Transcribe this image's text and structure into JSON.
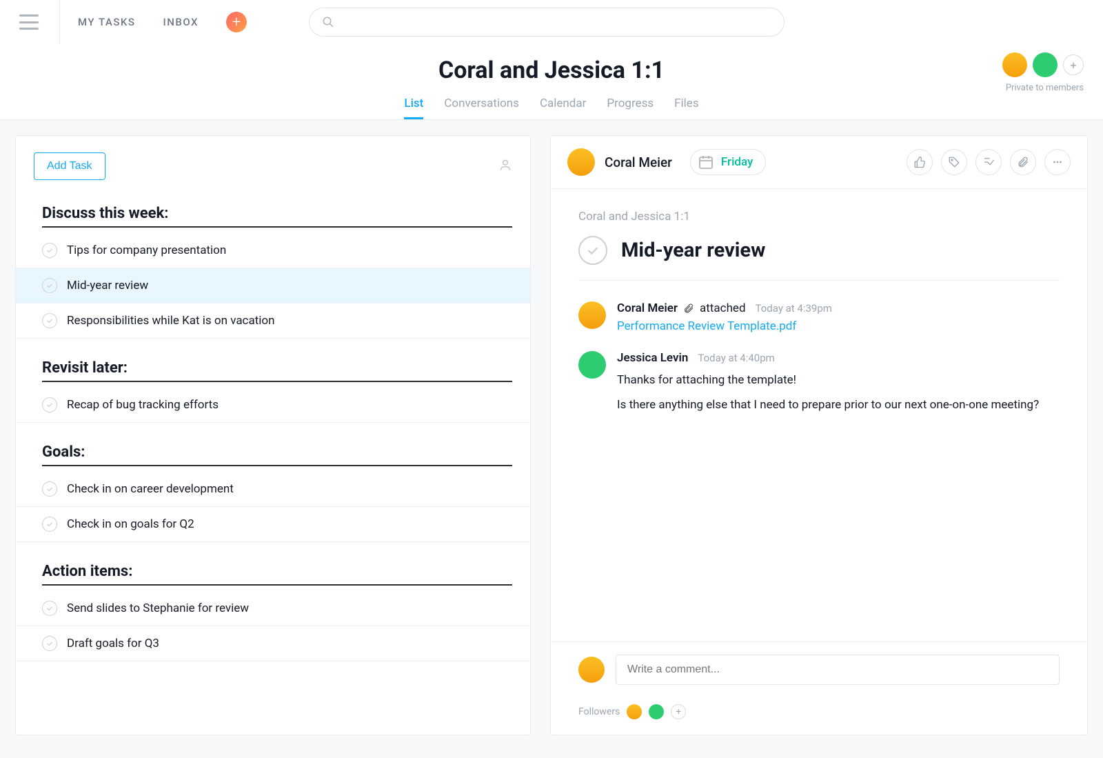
{
  "nav": {
    "my_tasks": "MY TASKS",
    "inbox": "INBOX",
    "search_placeholder": ""
  },
  "project": {
    "title": "Coral and Jessica 1:1",
    "privacy": "Private to members",
    "tabs": {
      "list": "List",
      "conversations": "Conversations",
      "calendar": "Calendar",
      "progress": "Progress",
      "files": "Files"
    }
  },
  "left": {
    "add_task": "Add Task",
    "sections": [
      {
        "title": "Discuss this week:",
        "tasks": [
          {
            "name": "Tips for company presentation"
          },
          {
            "name": "Mid-year review",
            "selected": true
          },
          {
            "name": "Responsibilities while Kat is on vacation"
          }
        ]
      },
      {
        "title": "Revisit later:",
        "tasks": [
          {
            "name": "Recap of bug tracking efforts"
          }
        ]
      },
      {
        "title": "Goals:",
        "tasks": [
          {
            "name": "Check in on career development"
          },
          {
            "name": "Check in on goals for Q2"
          }
        ]
      },
      {
        "title": "Action items:",
        "tasks": [
          {
            "name": "Send slides to Stephanie for review"
          },
          {
            "name": "Draft goals for Q3"
          }
        ]
      }
    ]
  },
  "detail": {
    "assignee": "Coral Meier",
    "due": "Friday",
    "breadcrumb": "Coral and Jessica 1:1",
    "title": "Mid-year review",
    "activity": [
      {
        "author": "Coral Meier",
        "verb": "attached",
        "time": "Today at 4:39pm",
        "attachment": "Performance Review Template.pdf"
      },
      {
        "author": "Jessica Levin",
        "time": "Today at 4:40pm",
        "text1": "Thanks for attaching the template!",
        "text2": "Is there anything else that I need to prepare prior to our next one-on-one meeting?"
      }
    ],
    "comment_placeholder": "Write a comment...",
    "followers_label": "Followers"
  }
}
